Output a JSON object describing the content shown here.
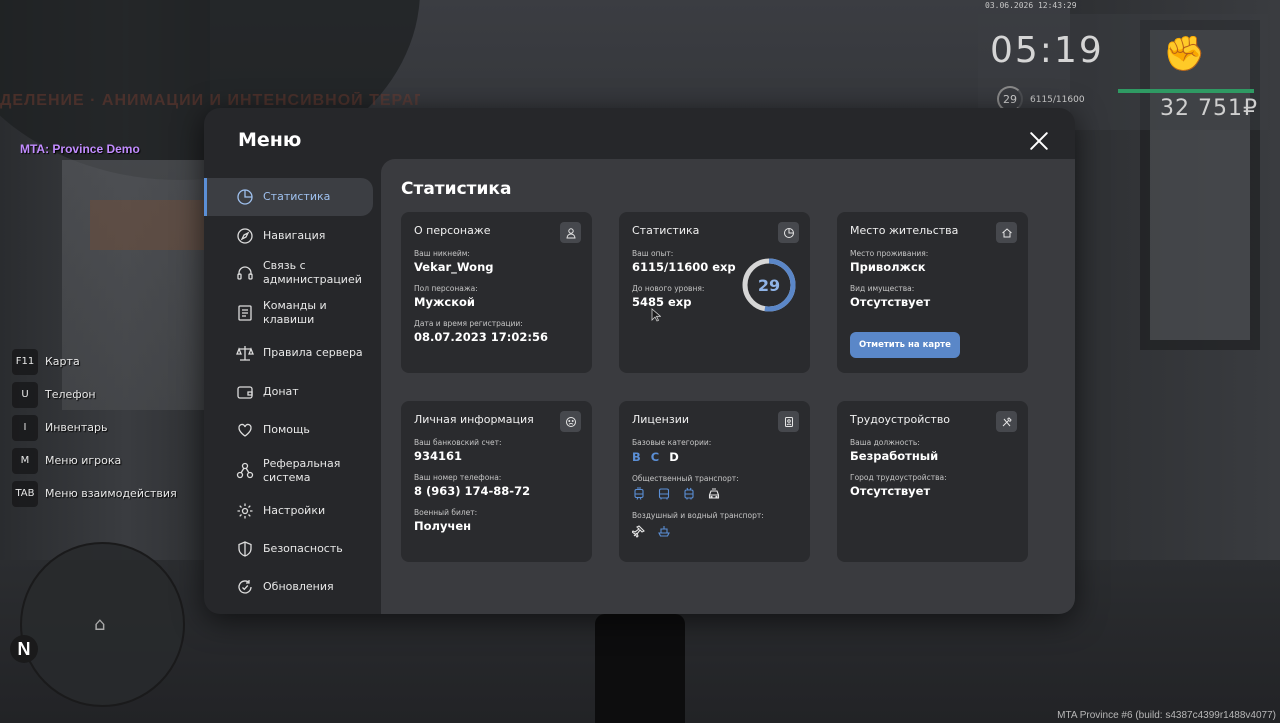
{
  "background": {
    "sign_text": "ДЕЛЕНИЕ · АНИМАЦИИ И ИНТЕНСИВНОЙ ТЕРАПИИ"
  },
  "hud": {
    "server_label": "MTA: Province Demo",
    "datetime": "03.06.2026 12:43:29",
    "time": "05:19",
    "level": "29",
    "exp": "6115/11600",
    "health_fraction": 1.0,
    "money": "32 751₽",
    "build_info": "MTA Province #6 (build: s4387c4399r1488v4077)",
    "minimap_north": "N",
    "hotkeys": [
      {
        "key": "F11",
        "label": "Карта"
      },
      {
        "key": "U",
        "label": "Телефон"
      },
      {
        "key": "I",
        "label": "Инвентарь"
      },
      {
        "key": "M",
        "label": "Меню игрока"
      },
      {
        "key": "TAB",
        "label": "Меню взаимодействия"
      }
    ]
  },
  "menu": {
    "title": "Меню",
    "sidebar": [
      {
        "line1": "Статистика",
        "line2": "",
        "icon": "stats-icon",
        "active": true
      },
      {
        "line1": "Навигация",
        "line2": "",
        "icon": "compass-icon"
      },
      {
        "line1": "Связь с",
        "line2": "администрацией",
        "icon": "headset-icon"
      },
      {
        "line1": "Команды и",
        "line2": "клавиши",
        "icon": "commands-icon"
      },
      {
        "line1": "Правила сервера",
        "line2": "",
        "icon": "scales-icon"
      },
      {
        "line1": "Донат",
        "line2": "",
        "icon": "wallet-icon"
      },
      {
        "line1": "Помощь",
        "line2": "",
        "icon": "heart-hands-icon"
      },
      {
        "line1": "Реферальная",
        "line2": "система",
        "icon": "referral-icon"
      },
      {
        "line1": "Настройки",
        "line2": "",
        "icon": "gear-icon"
      },
      {
        "line1": "Безопасность",
        "line2": "",
        "icon": "shield-icon"
      },
      {
        "line1": "Обновления",
        "line2": "",
        "icon": "refresh-icon"
      }
    ],
    "content_title": "Статистика",
    "character": {
      "title": "О персонаже",
      "nickname_label": "Ваш никнейм:",
      "nickname": "Vekar_Wong",
      "gender_label": "Пол персонажа:",
      "gender": "Мужской",
      "reg_label": "Дата и время регистрации:",
      "reg_date": "08.07.2023 17:02:56"
    },
    "stats": {
      "title": "Статистика",
      "exp_label": "Ваш опыт:",
      "exp": "6115/11600 exp",
      "next_label": "До нового уровня:",
      "next": "5485 exp",
      "level": "29",
      "level_progress": 0.527
    },
    "residence": {
      "title": "Место жительства",
      "place_label": "Место проживания:",
      "place": "Приволжск",
      "property_label": "Вид имущества:",
      "property": "Отсутствует",
      "map_button": "Отметить на карте"
    },
    "personal": {
      "title": "Личная информация",
      "bank_label": "Ваш банковский счет:",
      "bank": "934161",
      "phone_label": "Ваш номер телефона:",
      "phone": "8 (963) 174-88-72",
      "military_label": "Военный билет:",
      "military": "Получен"
    },
    "licenses": {
      "title": "Лицензии",
      "basic_label": "Базовые категории:",
      "categories": [
        {
          "letter": "B",
          "color": "#5b8fd6"
        },
        {
          "letter": "C",
          "color": "#5b8fd6"
        },
        {
          "letter": "D",
          "color": "#ffffff"
        }
      ],
      "public_label": "Общественный транспорт:",
      "air_label": "Воздушный и водный транспорт:"
    },
    "employment": {
      "title": "Трудоустройство",
      "position_label": "Ваша должность:",
      "position": "Безработный",
      "city_label": "Город трудоустройства:",
      "city": "Отсутствует"
    }
  }
}
